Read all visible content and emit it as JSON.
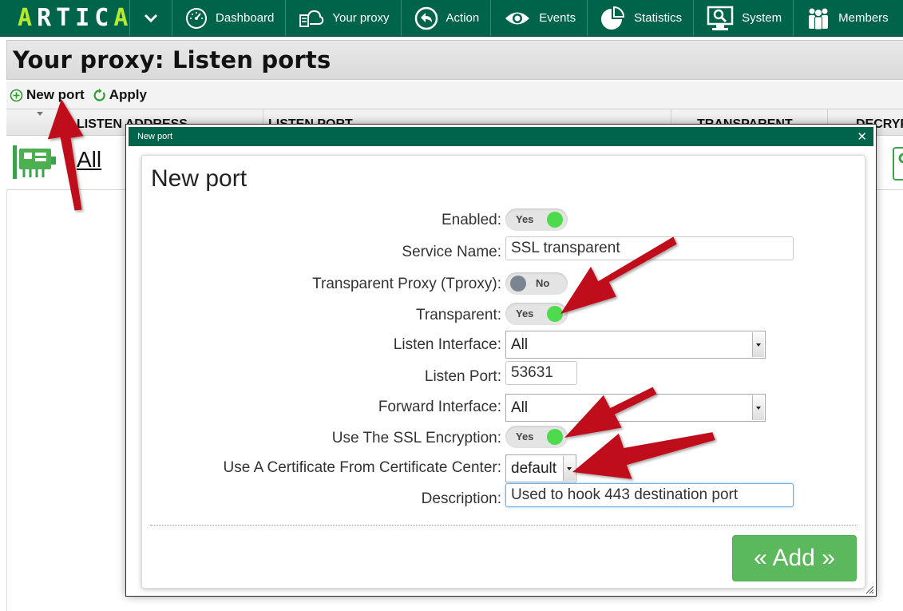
{
  "nav": {
    "logo": "ARTICA",
    "items": [
      {
        "label": "Dashboard",
        "icon": "gauge-icon"
      },
      {
        "label": "Your proxy",
        "icon": "proxy-cloud-icon"
      },
      {
        "label": "Action",
        "icon": "action-back-icon"
      },
      {
        "label": "Events",
        "icon": "eye-icon"
      },
      {
        "label": "Statistics",
        "icon": "pie-chart-icon"
      },
      {
        "label": "System",
        "icon": "system-monitor-icon"
      },
      {
        "label": "Members",
        "icon": "members-icon"
      }
    ]
  },
  "page": {
    "title": "Your proxy: Listen ports"
  },
  "toolbar": {
    "new_port_label": "New port",
    "apply_label": "Apply"
  },
  "table": {
    "columns": [
      "LISTEN ADDRESS",
      "LISTEN PORT",
      "TRANSPARENT",
      "DECRYPT"
    ],
    "rows": [
      {
        "address": "All"
      }
    ]
  },
  "modal": {
    "header_title": "New port",
    "panel_title": "New port",
    "fields": {
      "enabled": {
        "label": "Enabled:",
        "value": "Yes"
      },
      "service_name": {
        "label": "Service Name:",
        "value": "SSL transparent"
      },
      "tproxy": {
        "label": "Transparent Proxy (Tproxy):",
        "value": "No"
      },
      "transparent": {
        "label": "Transparent:",
        "value": "Yes"
      },
      "listen_interface": {
        "label": "Listen Interface:",
        "value": "All"
      },
      "listen_port": {
        "label": "Listen Port:",
        "value": "53631"
      },
      "forward_interface": {
        "label": "Forward Interface:",
        "value": "All"
      },
      "ssl_encryption": {
        "label": "Use The SSL Encryption:",
        "value": "Yes"
      },
      "certificate": {
        "label": "Use A Certificate From Certificate Center:",
        "value": "default"
      },
      "description": {
        "label": "Description:",
        "value": "Used to hook 443 destination port"
      }
    },
    "add_button": "« Add »"
  },
  "colors": {
    "brand_green": "#00644b",
    "logo_accent": "#b7ea2e",
    "switch_on": "#4ddb4d",
    "switch_off": "#7b8592",
    "add_button": "#5cb85c",
    "annotation_arrow": "#c0101a"
  }
}
